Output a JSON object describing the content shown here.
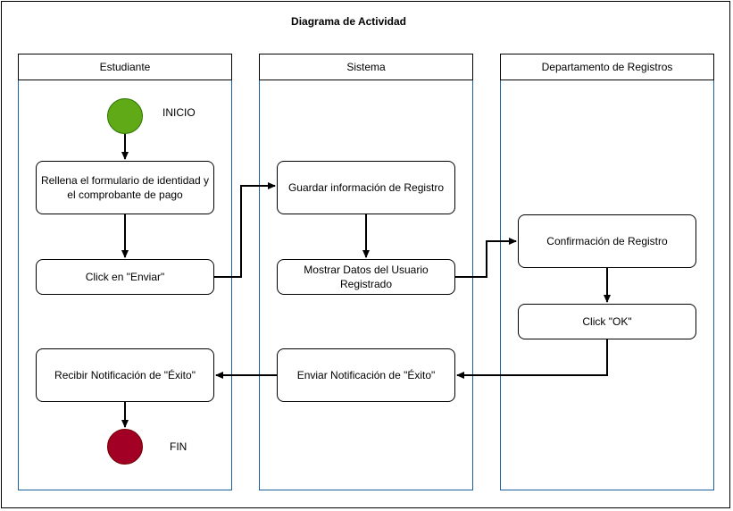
{
  "diagram": {
    "title": "Diagrama de Actividad",
    "lanes": {
      "student": "Estudiante",
      "system": "Sistema",
      "registry": "Departamento de Registros"
    },
    "nodes": {
      "start_label": "INICIO",
      "fill_form": "Rellena el formulario de identidad y el comprobante de pago",
      "click_send": "Click en \"Enviar\"",
      "save_info": "Guardar información de Registro",
      "show_data": "Mostrar Datos del Usuario Registrado",
      "confirm": "Confirmación de Registro",
      "click_ok": "Click \"OK\"",
      "send_notification": "Enviar Notificación de \"Éxito\"",
      "receive_notification": "Recibir Notificación de \"Éxito\"",
      "end_label": "FIN"
    },
    "colors": {
      "start": "#60a917",
      "end": "#a20025",
      "lane_border": "#1a5fa0"
    }
  }
}
